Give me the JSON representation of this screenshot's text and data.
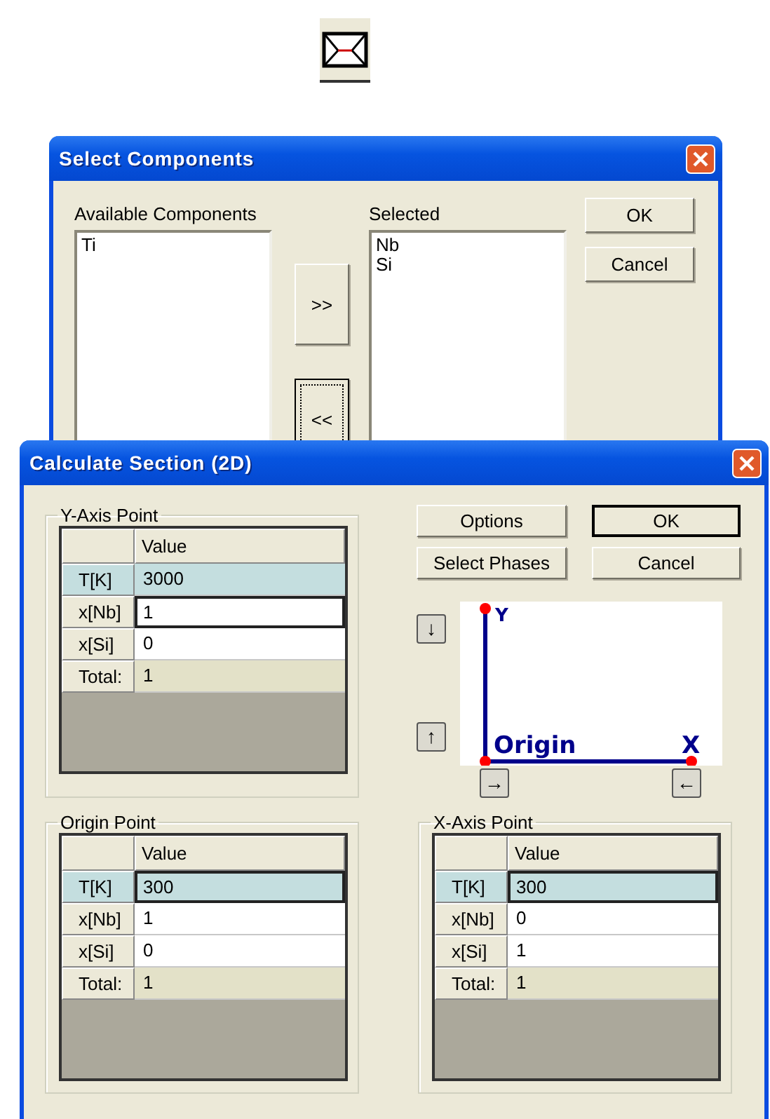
{
  "toolbar": {
    "mail_button": {
      "kind": "envelope"
    }
  },
  "select_components": {
    "title": "Select Components",
    "available": {
      "label": "Available Components",
      "items": [
        "Ti"
      ]
    },
    "selected": {
      "label": "Selected",
      "items": [
        "Nb",
        "Si"
      ]
    },
    "move_buttons": [
      {
        "label": ">>",
        "focused": false
      },
      {
        "label": "<<",
        "focused": true
      }
    ],
    "buttons": [
      "OK",
      "Cancel"
    ]
  },
  "calculate_section": {
    "title": "Calculate Section (2D)",
    "buttons": [
      {
        "label": "Options",
        "default": false
      },
      {
        "label": "OK",
        "default": true
      },
      {
        "label": "Select Phases",
        "default": false
      },
      {
        "label": "Cancel",
        "default": false
      }
    ],
    "arrow_buttons": [
      {
        "kind": "y_down",
        "label": "↓"
      },
      {
        "kind": "y_up",
        "label": "↑"
      },
      {
        "kind": "origin_right",
        "label": "→"
      },
      {
        "kind": "x_left",
        "label": "←"
      }
    ],
    "diagram": {
      "y_label": "Y",
      "origin_label": "Origin",
      "x_label": "X"
    },
    "groups": [
      {
        "title": "Y-Axis Point",
        "column": "Value",
        "rows": [
          {
            "label": "T[K]",
            "value": "3000",
            "kind": "entry",
            "selected": true,
            "focused": false
          },
          {
            "label": "x[Nb]",
            "value": "1",
            "kind": "entry",
            "selected": false,
            "focused": true
          },
          {
            "label": "x[Si]",
            "value": "0",
            "kind": "entry",
            "selected": false,
            "focused": false
          },
          {
            "label": "Total:",
            "value": "1",
            "kind": "total",
            "selected": false,
            "focused": false
          }
        ]
      },
      {
        "title": "Origin Point",
        "column": "Value",
        "rows": [
          {
            "label": "T[K]",
            "value": "300",
            "kind": "entry",
            "selected": true,
            "focused": true
          },
          {
            "label": "x[Nb]",
            "value": "1",
            "kind": "entry",
            "selected": false,
            "focused": false
          },
          {
            "label": "x[Si]",
            "value": "0",
            "kind": "entry",
            "selected": false,
            "focused": false
          },
          {
            "label": "Total:",
            "value": "1",
            "kind": "total",
            "selected": false,
            "focused": false
          }
        ]
      },
      {
        "title": "X-Axis Point",
        "column": "Value",
        "rows": [
          {
            "label": "T[K]",
            "value": "300",
            "kind": "entry",
            "selected": true,
            "focused": true
          },
          {
            "label": "x[Nb]",
            "value": "0",
            "kind": "entry",
            "selected": false,
            "focused": false
          },
          {
            "label": "x[Si]",
            "value": "1",
            "kind": "entry",
            "selected": false,
            "focused": false
          },
          {
            "label": "Total:",
            "value": "1",
            "kind": "total",
            "selected": false,
            "focused": false
          }
        ]
      }
    ]
  }
}
